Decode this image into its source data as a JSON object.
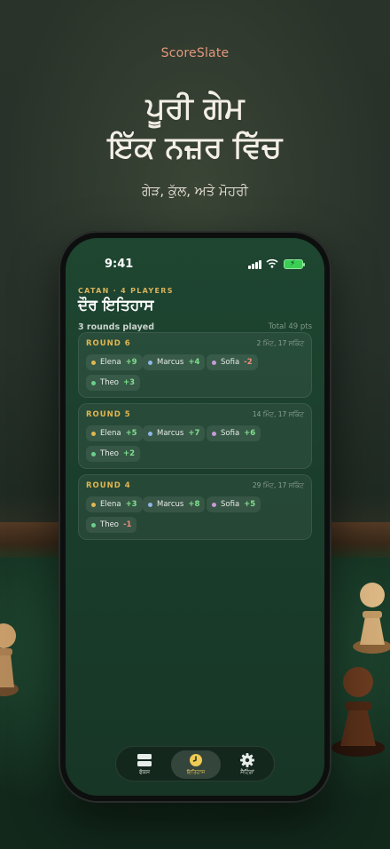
{
  "brand": "ScoreSlate",
  "headline": {
    "line1": "ਪੂਰੀ ਗੇਮ",
    "line2": "ਇੱਕ ਨਜ਼ਰ ਵਿੱਚ"
  },
  "subline": "ਗੇੜ, ਕੁੱਲ, ਅਤੇ ਮੋਹਰੀ",
  "status_bar": {
    "time": "9:41"
  },
  "screen": {
    "eyebrow": "CATAN · 4 PLAYERS",
    "title": "ਦੌਰ ਇਤਿਹਾਸ",
    "rounds_played": "3 rounds played",
    "total": "Total 49 pts"
  },
  "colors": {
    "elena": "#e2b64f",
    "marcus": "#8fb6e6",
    "sofia": "#c89ad6",
    "theo": "#6ccf8b",
    "accent": "#efca55"
  },
  "rounds": [
    {
      "label": "ROUND 6",
      "time": "2 ਮਿੰਟ, 17 ਸਕਿੰਟ",
      "scores": [
        {
          "player": "Elena",
          "delta": "+9"
        },
        {
          "player": "Marcus",
          "delta": "+4"
        },
        {
          "player": "Sofia",
          "delta": "-2"
        },
        {
          "player": "Theo",
          "delta": "+3"
        }
      ]
    },
    {
      "label": "ROUND 5",
      "time": "14 ਮਿੰਟ, 17 ਸਕਿੰਟ",
      "scores": [
        {
          "player": "Elena",
          "delta": "+5"
        },
        {
          "player": "Marcus",
          "delta": "+7"
        },
        {
          "player": "Sofia",
          "delta": "+6"
        },
        {
          "player": "Theo",
          "delta": "+2"
        }
      ]
    },
    {
      "label": "ROUND 4",
      "time": "29 ਮਿੰਟ, 17 ਸਕਿੰਟ",
      "scores": [
        {
          "player": "Elena",
          "delta": "+3"
        },
        {
          "player": "Marcus",
          "delta": "+8"
        },
        {
          "player": "Sofia",
          "delta": "+5"
        },
        {
          "player": "Theo",
          "delta": "-1"
        }
      ]
    }
  ],
  "tabs": [
    {
      "label": "ਫੋਕਸ",
      "icon": "layers-icon"
    },
    {
      "label": "ਇਤਿਹਾਸ",
      "icon": "clock-icon",
      "active": true
    },
    {
      "label": "ਸੈਟਿੰਗਾਂ",
      "icon": "gear-icon"
    }
  ]
}
